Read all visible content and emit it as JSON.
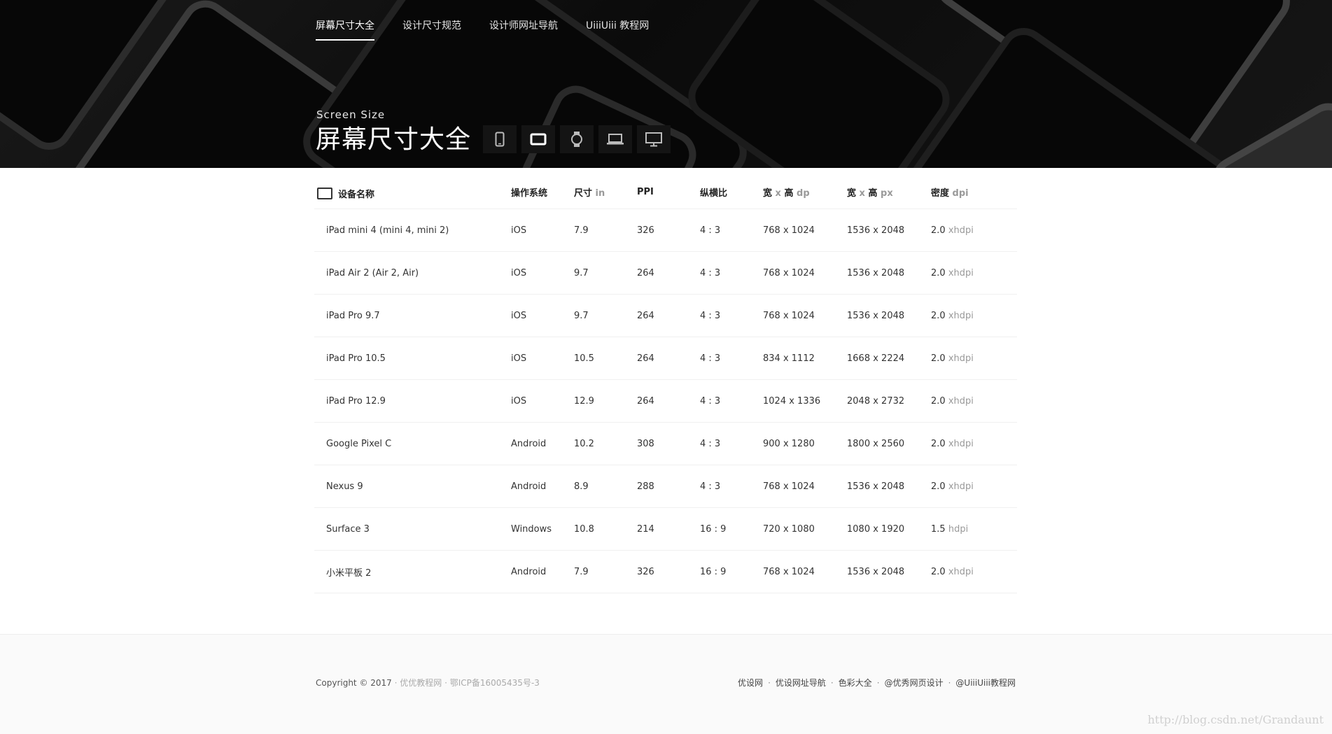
{
  "nav": {
    "items": [
      {
        "label": "屏幕尺寸大全",
        "active": true
      },
      {
        "label": "设计尺寸规范",
        "active": false
      },
      {
        "label": "设计师网址导航",
        "active": false
      },
      {
        "label": "UiiiUiii 教程网",
        "active": false
      }
    ]
  },
  "hero": {
    "subtitle": "Screen Size",
    "title": "屏幕尺寸大全",
    "device_tabs": [
      {
        "icon": "phone-icon",
        "active": false
      },
      {
        "icon": "tablet-icon",
        "active": true
      },
      {
        "icon": "watch-icon",
        "active": false
      },
      {
        "icon": "laptop-icon",
        "active": false
      },
      {
        "icon": "desktop-icon",
        "active": false
      }
    ]
  },
  "table": {
    "headers": {
      "device": "设备名称",
      "os": "操作系统",
      "size": "尺寸",
      "size_unit": "in",
      "ppi": "PPI",
      "ratio": "纵横比",
      "dp_label": "宽",
      "dp_x": "x",
      "dp_label2": "高",
      "dp_unit": "dp",
      "px_label": "宽",
      "px_x": "x",
      "px_label2": "高",
      "px_unit": "px",
      "density": "密度",
      "density_unit": "dpi"
    },
    "rows": [
      {
        "device": "iPad mini 4 (mini 4, mini 2)",
        "os": "iOS",
        "size": "7.9",
        "ppi": "326",
        "ratio": "4 : 3",
        "dp": "768 x 1024",
        "px": "1536 x 2048",
        "density": "2.0",
        "density_name": "xhdpi"
      },
      {
        "device": "iPad Air 2 (Air 2, Air)",
        "os": "iOS",
        "size": "9.7",
        "ppi": "264",
        "ratio": "4 : 3",
        "dp": "768 x 1024",
        "px": "1536 x 2048",
        "density": "2.0",
        "density_name": "xhdpi"
      },
      {
        "device": "iPad Pro 9.7",
        "os": "iOS",
        "size": "9.7",
        "ppi": "264",
        "ratio": "4 : 3",
        "dp": "768 x 1024",
        "px": "1536 x 2048",
        "density": "2.0",
        "density_name": "xhdpi"
      },
      {
        "device": "iPad Pro 10.5",
        "os": "iOS",
        "size": "10.5",
        "ppi": "264",
        "ratio": "4 : 3",
        "dp": "834 x 1112",
        "px": "1668 x 2224",
        "density": "2.0",
        "density_name": "xhdpi"
      },
      {
        "device": "iPad Pro 12.9",
        "os": "iOS",
        "size": "12.9",
        "ppi": "264",
        "ratio": "4 : 3",
        "dp": "1024 x 1336",
        "px": "2048 x 2732",
        "density": "2.0",
        "density_name": "xhdpi"
      },
      {
        "device": "Google Pixel C",
        "os": "Android",
        "size": "10.2",
        "ppi": "308",
        "ratio": "4 : 3",
        "dp": "900 x 1280",
        "px": "1800 x 2560",
        "density": "2.0",
        "density_name": "xhdpi"
      },
      {
        "device": "Nexus 9",
        "os": "Android",
        "size": "8.9",
        "ppi": "288",
        "ratio": "4 : 3",
        "dp": "768 x 1024",
        "px": "1536 x 2048",
        "density": "2.0",
        "density_name": "xhdpi"
      },
      {
        "device": "Surface 3",
        "os": "Windows",
        "size": "10.8",
        "ppi": "214",
        "ratio": "16 : 9",
        "dp": "720 x 1080",
        "px": "1080 x 1920",
        "density": "1.5",
        "density_name": "hdpi"
      },
      {
        "device": "小米平板 2",
        "os": "Android",
        "size": "7.9",
        "ppi": "326",
        "ratio": "16 : 9",
        "dp": "768 x 1024",
        "px": "1536 x 2048",
        "density": "2.0",
        "density_name": "xhdpi"
      }
    ]
  },
  "footer": {
    "copyright": "Copyright © 2017",
    "copyright_suffix": "· 优优教程网 · 鄂ICP备16005435号-3",
    "links": [
      "优设网",
      "优设网址导航",
      "色彩大全",
      "@优秀网页设计",
      "@UiiiUiii教程网"
    ],
    "watermark": "http://blog.csdn.net/Grandaunt"
  }
}
